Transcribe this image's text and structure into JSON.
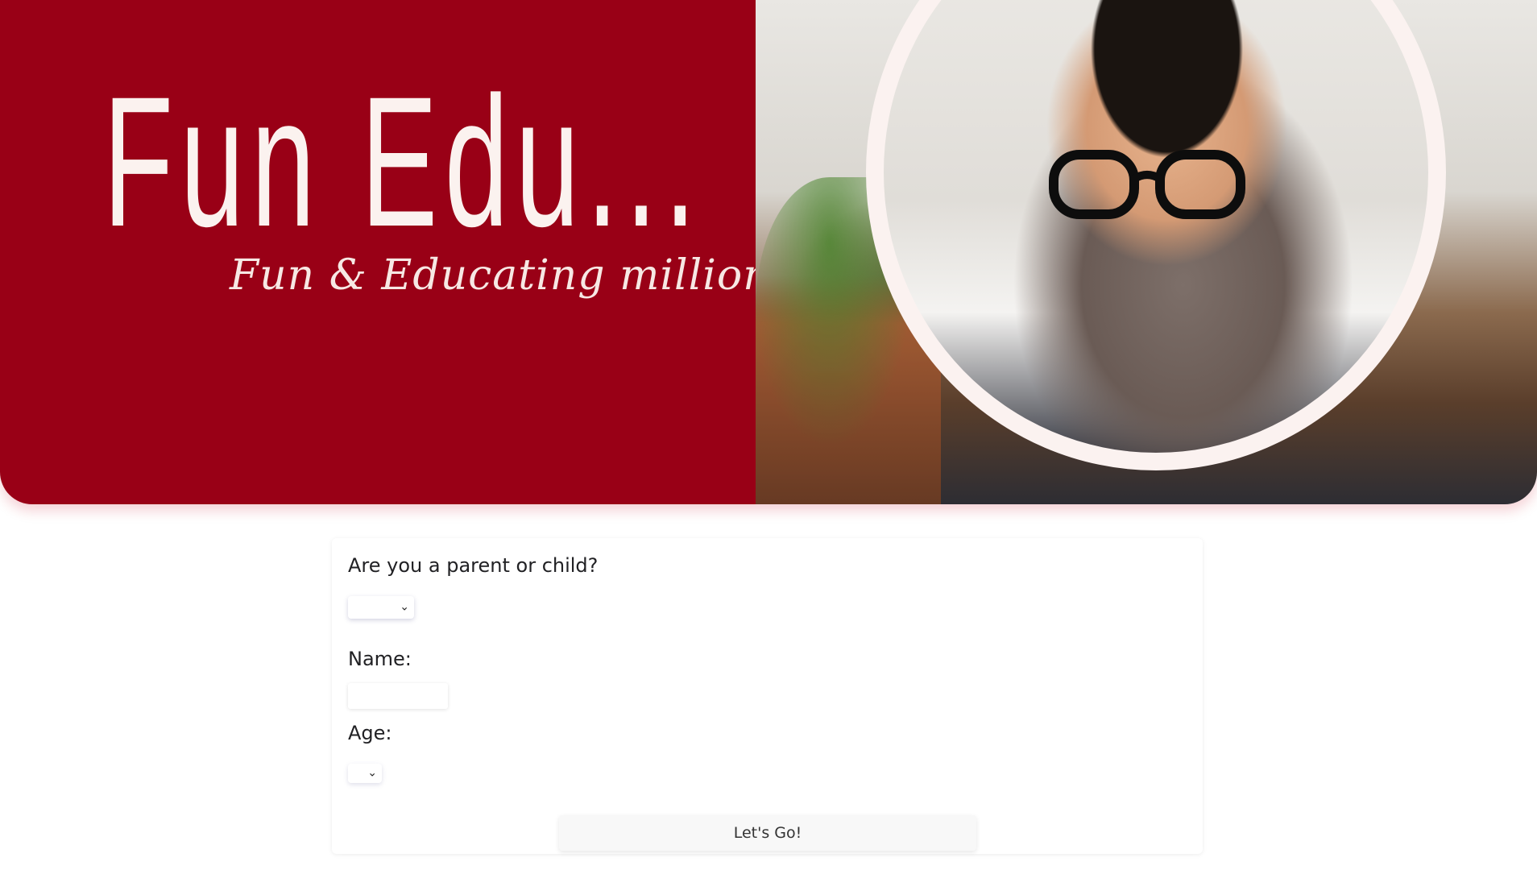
{
  "hero": {
    "title": "Fun Edu...",
    "tagline": "Fun & Educating millions...",
    "bg_color": "#990016",
    "text_color": "#fbf2ef"
  },
  "form": {
    "role_label": "Are you a parent or child?",
    "role_value": "",
    "name_label": "Name:",
    "name_value": "",
    "age_label": "Age:",
    "age_value": "",
    "submit_label": "Let's Go!"
  },
  "icons": {
    "dropdown": "chevron-down-icon"
  }
}
